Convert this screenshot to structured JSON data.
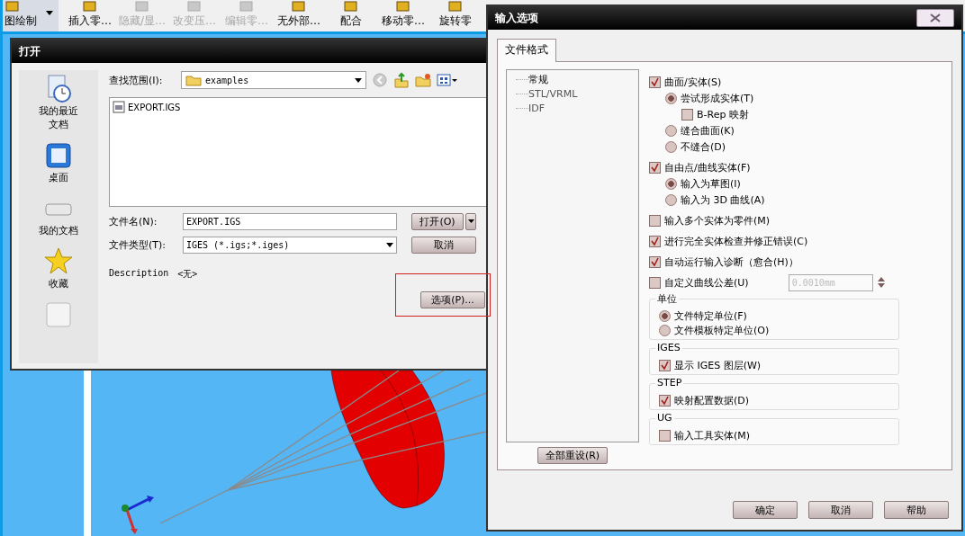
{
  "toolbar": {
    "items": [
      {
        "label": "图绘制",
        "disabled": false,
        "dropdown": true
      },
      {
        "label": "插入零…",
        "disabled": false,
        "dropdown": false
      },
      {
        "label": "隐藏/显…",
        "disabled": true,
        "dropdown": false
      },
      {
        "label": "改变压…",
        "disabled": true,
        "dropdown": false
      },
      {
        "label": "编辑零…",
        "disabled": true,
        "dropdown": false
      },
      {
        "label": "无外部…",
        "disabled": false,
        "dropdown": false
      },
      {
        "label": "配合",
        "disabled": false,
        "dropdown": false
      },
      {
        "label": "移动零…",
        "disabled": false,
        "dropdown": false
      },
      {
        "label": "旋转零",
        "disabled": false,
        "dropdown": false
      }
    ]
  },
  "open_dialog": {
    "title": "打开",
    "places": [
      {
        "label": "我的最近文档"
      },
      {
        "label": "桌面"
      },
      {
        "label": "我的文档"
      },
      {
        "label": "收藏"
      }
    ],
    "look_in": {
      "label": "查找范围(I):",
      "value": "examples"
    },
    "files": [
      {
        "name": "EXPORT.IGS"
      }
    ],
    "file_name": {
      "label": "文件名(N):",
      "value": "EXPORT.IGS"
    },
    "file_type": {
      "label": "文件类型(T):",
      "value": "IGES (*.igs;*.iges)"
    },
    "description": {
      "label": "Description",
      "value": "<无>"
    },
    "open_button": {
      "label": "打开(O)"
    },
    "cancel_button": {
      "label": "取消"
    },
    "options_button": {
      "label": "选项(P)...",
      "highlighted": true
    }
  },
  "options_dialog": {
    "title": "输入选项",
    "tabs": [
      {
        "label": "文件格式",
        "selected": true
      }
    ],
    "tree": [
      {
        "label": "常规",
        "selected": true
      },
      {
        "label": "STL/VRML",
        "selected": false
      },
      {
        "label": "IDF",
        "selected": false
      }
    ],
    "options": [
      {
        "kind": "checkbox",
        "label": "曲面/实体(S)",
        "checked": true,
        "children": [
          {
            "kind": "radio",
            "label": "尝试形成实体(T)",
            "selected": true,
            "children": [
              {
                "kind": "checkbox",
                "label": "B-Rep 映射",
                "checked": false
              }
            ]
          },
          {
            "kind": "radio",
            "label": "缝合曲面(K)",
            "selected": false
          },
          {
            "kind": "radio",
            "label": "不缝合(D)",
            "selected": false
          }
        ]
      },
      {
        "kind": "checkbox",
        "label": "自由点/曲线实体(F)",
        "checked": true,
        "children": [
          {
            "kind": "radio",
            "label": "输入为草图(I)",
            "selected": true
          },
          {
            "kind": "radio",
            "label": "输入为 3D 曲线(A)",
            "selected": false
          }
        ]
      },
      {
        "kind": "checkbox",
        "label": "输入多个实体为零件(M)",
        "checked": false
      },
      {
        "kind": "checkbox",
        "label": "进行完全实体检查并修正错误(C)",
        "checked": true
      },
      {
        "kind": "checkbox",
        "label": "自动运行输入诊断（愈合(H)）",
        "checked": true
      },
      {
        "kind": "checkbox",
        "label": "自定义曲线公差(U)",
        "checked": false,
        "field": {
          "value": "0.0010mm",
          "disabled": true
        }
      }
    ],
    "groups": [
      {
        "title": "单位",
        "options": [
          {
            "kind": "radio",
            "label": "文件特定单位(F)",
            "selected": true
          },
          {
            "kind": "radio",
            "label": "文件模板特定单位(O)",
            "selected": false
          }
        ]
      },
      {
        "title": "IGES",
        "options": [
          {
            "kind": "checkbox",
            "label": "显示 IGES 图层(W)",
            "checked": true
          }
        ]
      },
      {
        "title": "STEP",
        "options": [
          {
            "kind": "checkbox",
            "label": "映射配置数据(D)",
            "checked": true
          }
        ]
      },
      {
        "title": "UG",
        "options": [
          {
            "kind": "checkbox",
            "label": "输入工具实体(M)",
            "checked": false
          }
        ]
      }
    ],
    "reset_button": {
      "label": "全部重设(R)"
    },
    "buttons": [
      {
        "label": "确定"
      },
      {
        "label": "取消"
      },
      {
        "label": "帮助"
      }
    ]
  }
}
